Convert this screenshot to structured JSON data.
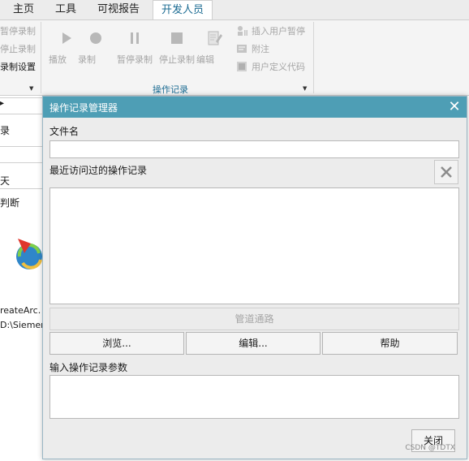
{
  "ribbon_tabs": [
    {
      "label": "主页"
    },
    {
      "label": "工具"
    },
    {
      "label": "可视报告"
    },
    {
      "label": "开发人员",
      "active": true
    }
  ],
  "ribbon": {
    "left_cut": {
      "pause_record": "暂停录制",
      "stop_record": "停止录制",
      "record_settings": "录制设置"
    },
    "buttons": {
      "play": "播放",
      "record": "录制",
      "pause_record": "暂停录制",
      "stop_record": "停止录制",
      "edit": "编辑"
    },
    "small_buttons": {
      "insert_pause": "插入用户暂停",
      "annotation": "附注",
      "user_code": "用户定义代码"
    },
    "group_title": "操作记录"
  },
  "left_panel": {
    "heading_cut": "录",
    "day_cut": "天",
    "judge_cut": "判断",
    "file_cut": "reateArc.",
    "path_cut": "D:\\Siemen"
  },
  "dialog": {
    "title": "操作记录管理器",
    "filename_label": "文件名",
    "filename_value": "",
    "recent_label": "最近访问过的操作记录",
    "pipeline_button": "管道通路",
    "browse_button": "浏览...",
    "edit_button": "编辑...",
    "help_button": "帮助",
    "params_label": "输入操作记录参数",
    "params_value": "",
    "close_button": "关闭"
  },
  "watermark": "CSDN @TDTX",
  "colors": {
    "title_bar": "#4e9eb5",
    "active_tab_text": "#1b6b92",
    "disabled_text": "#a6a6a6"
  }
}
